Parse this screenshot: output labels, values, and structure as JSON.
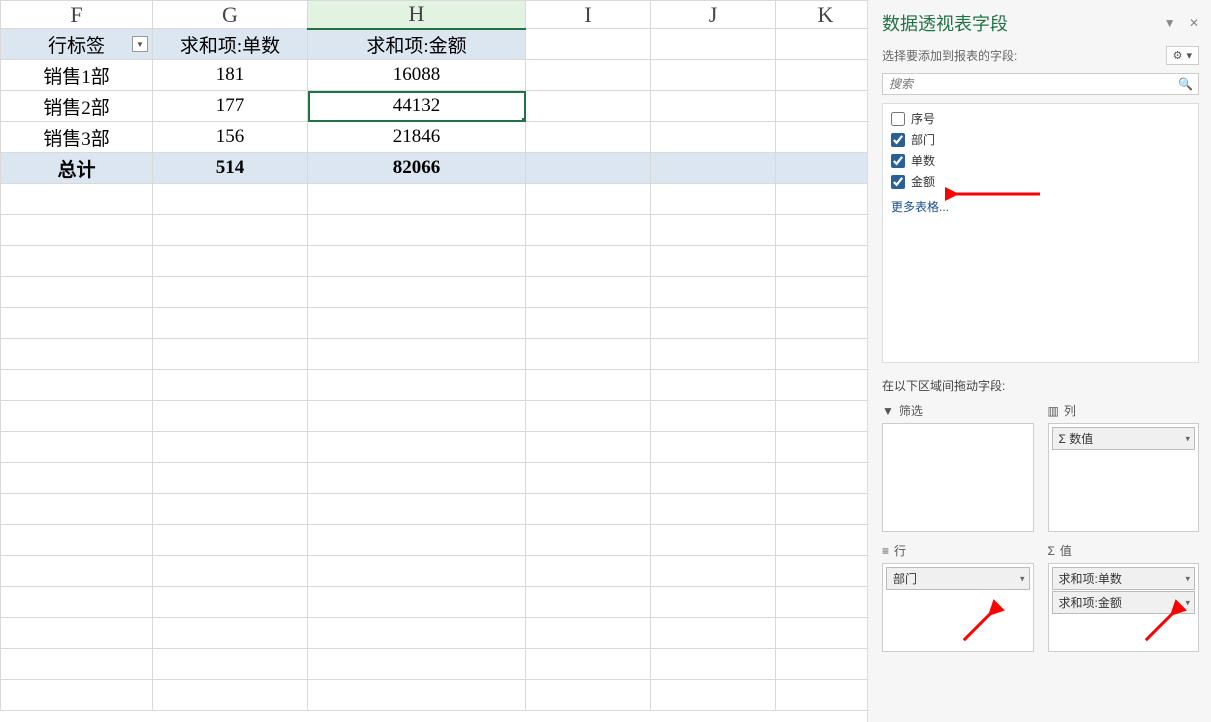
{
  "columns": [
    "F",
    "G",
    "H",
    "I",
    "J",
    "K"
  ],
  "selected_col": "H",
  "pivot": {
    "headers": [
      "行标签",
      "求和项:单数",
      "求和项:金额"
    ],
    "rows": [
      {
        "label": "销售1部",
        "orders": "181",
        "amount": "16088"
      },
      {
        "label": "销售2部",
        "orders": "177",
        "amount": "44132"
      },
      {
        "label": "销售3部",
        "orders": "156",
        "amount": "21846"
      }
    ],
    "total_label": "总计",
    "total_orders": "514",
    "total_amount": "82066",
    "selected_cell": {
      "row": 1,
      "col": "amount"
    }
  },
  "pane": {
    "title": "数据透视表字段",
    "subtitle": "选择要添加到报表的字段:",
    "search_placeholder": "搜索",
    "fields": [
      {
        "name": "序号",
        "checked": false
      },
      {
        "name": "部门",
        "checked": true
      },
      {
        "name": "单数",
        "checked": true
      },
      {
        "name": "金额",
        "checked": true
      }
    ],
    "more_tables": "更多表格...",
    "areas_header": "在以下区域间拖动字段:",
    "filter_label": "筛选",
    "columns_label": "列",
    "rows_label": "行",
    "values_label": "值",
    "columns_items": [
      "Σ 数值"
    ],
    "rows_items": [
      "部门"
    ],
    "values_items": [
      "求和项:单数",
      "求和项:金额"
    ]
  }
}
